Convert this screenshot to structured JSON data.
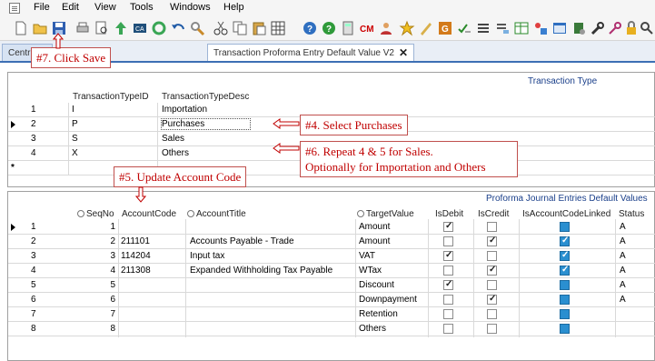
{
  "menu": [
    "File",
    "Edit",
    "View",
    "Tools",
    "Windows",
    "Help"
  ],
  "tabs": {
    "left": "Centr",
    "active": "Transaction Proforma Entry Default Value V2"
  },
  "transaction_type": {
    "caption": "Transaction Type",
    "headers": [
      "TransactionTypeID",
      "TransactionTypeDesc"
    ],
    "rows": [
      {
        "n": "1",
        "id": "I",
        "desc": "Importation"
      },
      {
        "n": "2",
        "id": "P",
        "desc": "Purchases"
      },
      {
        "n": "3",
        "id": "S",
        "desc": "Sales"
      },
      {
        "n": "4",
        "id": "X",
        "desc": "Others"
      }
    ],
    "new_row_marker": "*"
  },
  "journal": {
    "caption": "Proforma Journal Entries Default Values",
    "headers": [
      "SeqNo",
      "AccountCode",
      "AccountTitle",
      "TargetValue",
      "IsDebit",
      "IsCredit",
      "IsAccountCodeLinked",
      "Status"
    ],
    "rows": [
      {
        "n": "1",
        "seq": "1",
        "code": "",
        "title": "",
        "target": "Amount",
        "debit": true,
        "credit": false,
        "linked": false,
        "status": "A"
      },
      {
        "n": "2",
        "seq": "2",
        "code": "211101",
        "title": "Accounts Payable - Trade",
        "target": "Amount",
        "debit": false,
        "credit": true,
        "linked": true,
        "status": "A"
      },
      {
        "n": "3",
        "seq": "3",
        "code": "114204",
        "title": "Input tax",
        "target": "VAT",
        "debit": true,
        "credit": false,
        "linked": true,
        "status": "A"
      },
      {
        "n": "4",
        "seq": "4",
        "code": "211308",
        "title": "Expanded Withholding Tax Payable",
        "target": "WTax",
        "debit": false,
        "credit": true,
        "linked": true,
        "status": "A"
      },
      {
        "n": "5",
        "seq": "5",
        "code": "",
        "title": "",
        "target": "Discount",
        "debit": true,
        "credit": false,
        "linked": false,
        "status": "A"
      },
      {
        "n": "6",
        "seq": "6",
        "code": "",
        "title": "",
        "target": "Downpayment",
        "debit": false,
        "credit": true,
        "linked": false,
        "status": "A"
      },
      {
        "n": "7",
        "seq": "7",
        "code": "",
        "title": "",
        "target": "Retention",
        "debit": false,
        "credit": false,
        "linked": false,
        "status": ""
      },
      {
        "n": "8",
        "seq": "8",
        "code": "",
        "title": "",
        "target": "Others",
        "debit": false,
        "credit": false,
        "linked": false,
        "status": ""
      }
    ]
  },
  "notes": {
    "n4": "#4. Select Purchases",
    "n5": "#5. Update Account Code",
    "n6a": "#6. Repeat 4 & 5 for  Sales.",
    "n6b": "Optionally for Importation and Others",
    "n7": "#7. Click Save"
  },
  "colors": {
    "annotation": "#c00000",
    "caption": "#1a3f8a",
    "linked_checkbox": "#2a8fd0"
  }
}
